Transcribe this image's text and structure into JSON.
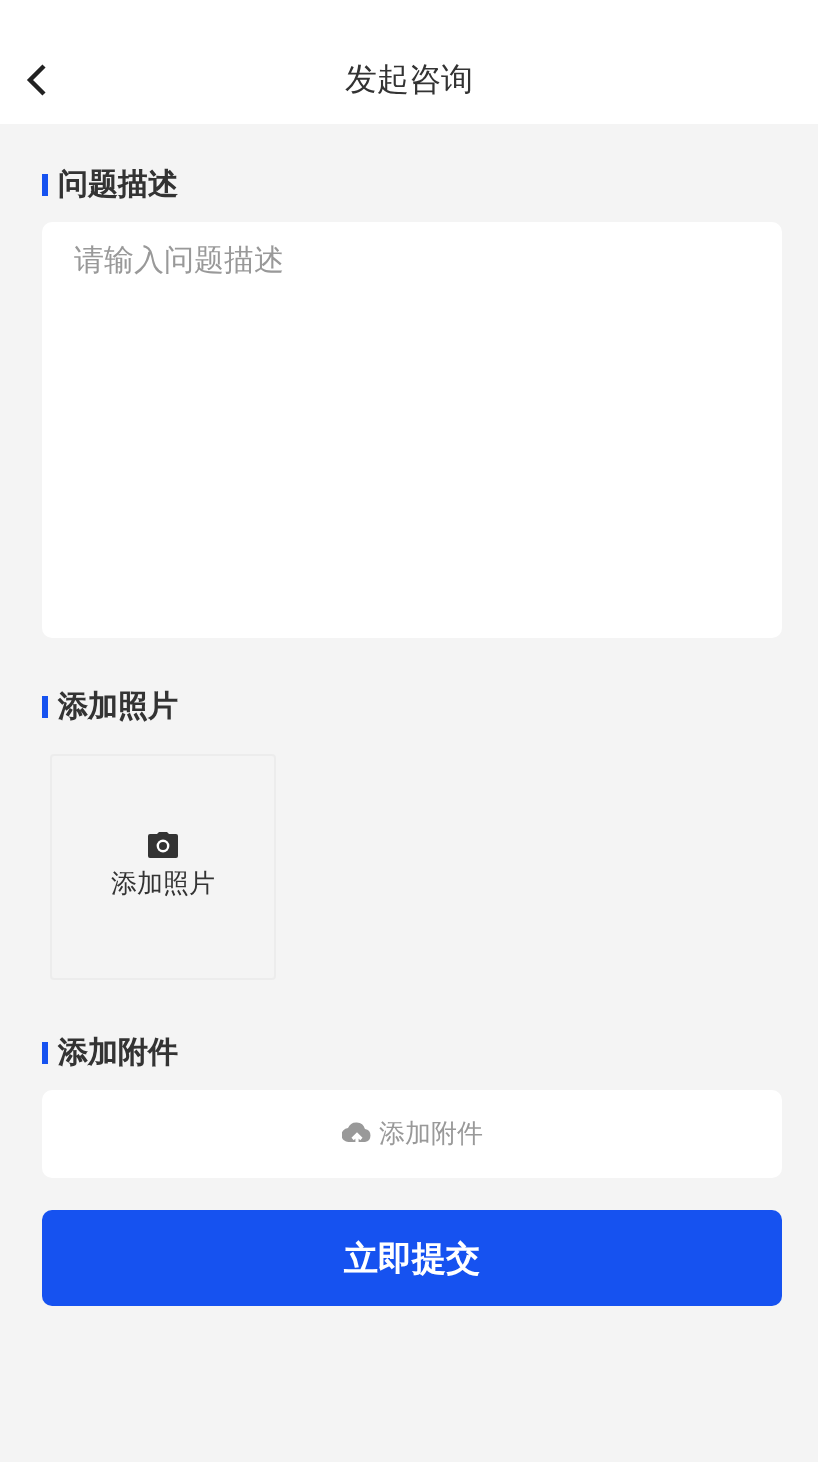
{
  "header": {
    "title": "发起咨询"
  },
  "sections": [
    {
      "kind": "textarea",
      "label": "问题描述",
      "placeholder": "请输入问题描述"
    },
    {
      "kind": "photo",
      "label": "添加照片",
      "button": "添加照片"
    },
    {
      "kind": "attachment",
      "label": "添加附件",
      "button": "添加附件"
    }
  ],
  "submit": "立即提交"
}
